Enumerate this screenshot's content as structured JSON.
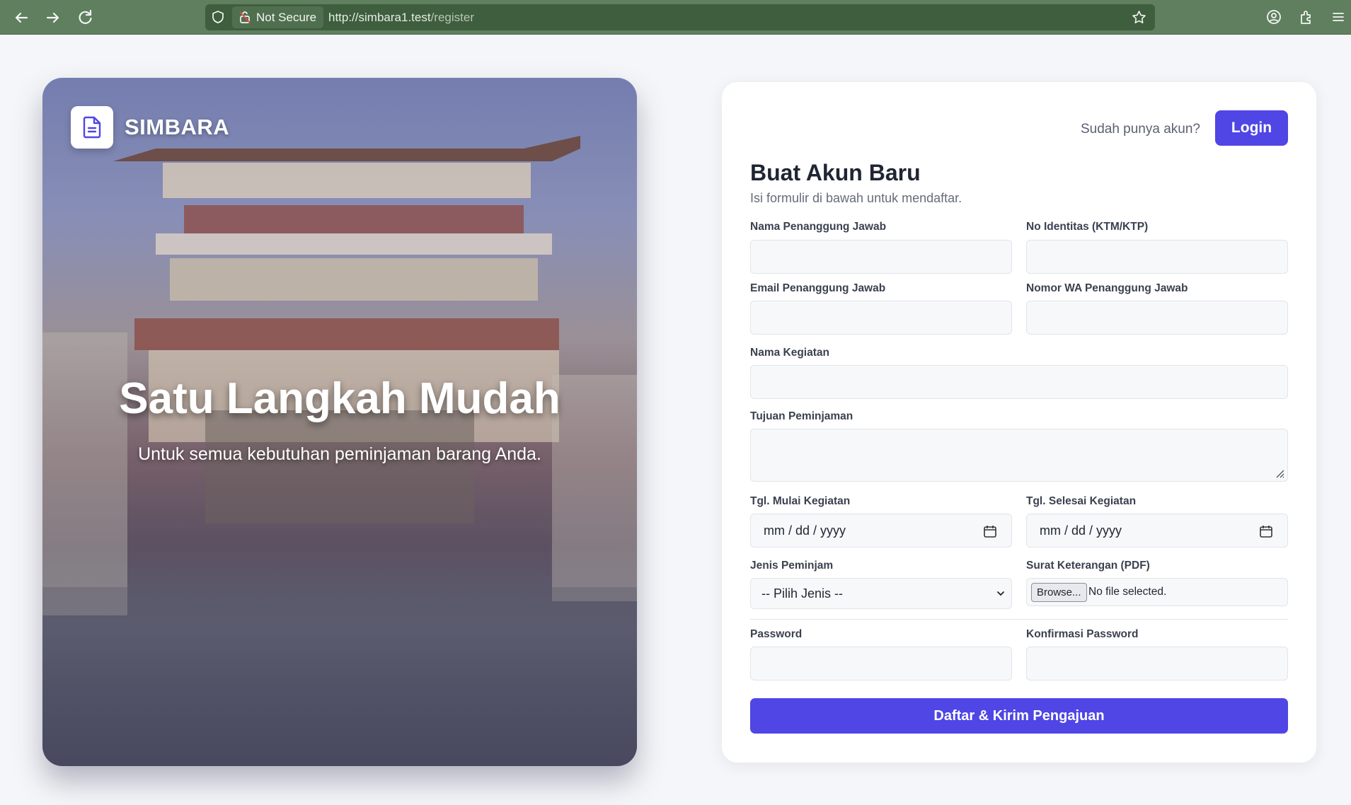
{
  "browser": {
    "security_label": "Not Secure",
    "url_host": "http://simbara1.test",
    "url_path": "/register",
    "icons": [
      "back-icon",
      "forward-icon",
      "reload-icon",
      "shield-icon",
      "lock-warning-icon",
      "star-icon",
      "account-icon",
      "extensions-icon",
      "menu-icon"
    ]
  },
  "hero": {
    "brand": "SIMBARA",
    "title": "Satu Langkah Mudah",
    "subtitle": "Untuk semua kebutuhan peminjaman barang Anda."
  },
  "auth": {
    "prompt": "Sudah punya akun?",
    "login_label": "Login"
  },
  "form": {
    "title": "Buat Akun Baru",
    "subtitle": "Isi formulir di bawah untuk mendaftar.",
    "fields": {
      "nama_pj": "Nama Penanggung Jawab",
      "no_identitas": "No Identitas (KTM/KTP)",
      "email_pj": "Email Penanggung Jawab",
      "nomor_wa": "Nomor WA Penanggung Jawab",
      "nama_kegiatan": "Nama Kegiatan",
      "tujuan": "Tujuan Peminjaman",
      "tgl_mulai": "Tgl. Mulai Kegiatan",
      "tgl_selesai": "Tgl. Selesai Kegiatan",
      "jenis": "Jenis Peminjam",
      "surat": "Surat Keterangan (PDF)",
      "password": "Password",
      "konfirmasi": "Konfirmasi Password"
    },
    "date_placeholder": "mm / dd / yyyy",
    "jenis_selected": "-- Pilih Jenis --",
    "browse_label": "Browse...",
    "no_file": "No file selected.",
    "submit_label": "Daftar & Kirim Pengajuan"
  },
  "colors": {
    "accent": "#4f46e5",
    "chrome": "#5f7f5f"
  }
}
